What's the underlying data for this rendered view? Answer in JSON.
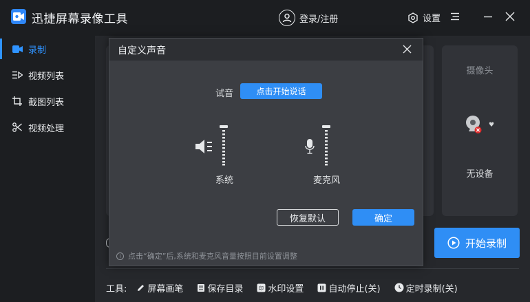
{
  "app": {
    "title": "迅捷屏幕录像工具",
    "login_label": "登录/注册",
    "settings_label": "设置"
  },
  "sidebar": {
    "items": [
      {
        "label": "录制",
        "icon": "video-camera-icon",
        "active": true
      },
      {
        "label": "视频列表",
        "icon": "video-list-icon",
        "active": false
      },
      {
        "label": "截图列表",
        "icon": "screenshot-list-icon",
        "active": false
      },
      {
        "label": "视频处理",
        "icon": "video-tools-icon",
        "active": false
      }
    ]
  },
  "camera": {
    "title": "摄像头",
    "status": "无设备"
  },
  "record": {
    "start_label": "开始录制"
  },
  "toolbar": {
    "label": "工具:",
    "items": [
      {
        "label": "屏幕画笔",
        "icon": "pen-icon"
      },
      {
        "label": "保存目录",
        "icon": "folder-icon"
      },
      {
        "label": "水印设置",
        "icon": "watermark-icon"
      },
      {
        "label": "自动停止(关)",
        "icon": "pause-icon"
      },
      {
        "label": "定时录制(关)",
        "icon": "clock-icon"
      }
    ]
  },
  "dialog": {
    "title": "自定义声音",
    "test_label": "试音",
    "test_button": "点击开始说话",
    "system_label": "系统",
    "mic_label": "麦克风",
    "system_volume": 1.0,
    "mic_volume": 1.0,
    "reset_button": "恢复默认",
    "ok_button": "确定",
    "note": "点击“确定”后,系统和麦克风音量按照目前设置调整"
  },
  "colors": {
    "accent": "#2f8ef5",
    "background": "#26282c",
    "titlebar": "#1c1e21",
    "panel": "#313338",
    "dialog": "#3c3e43"
  }
}
